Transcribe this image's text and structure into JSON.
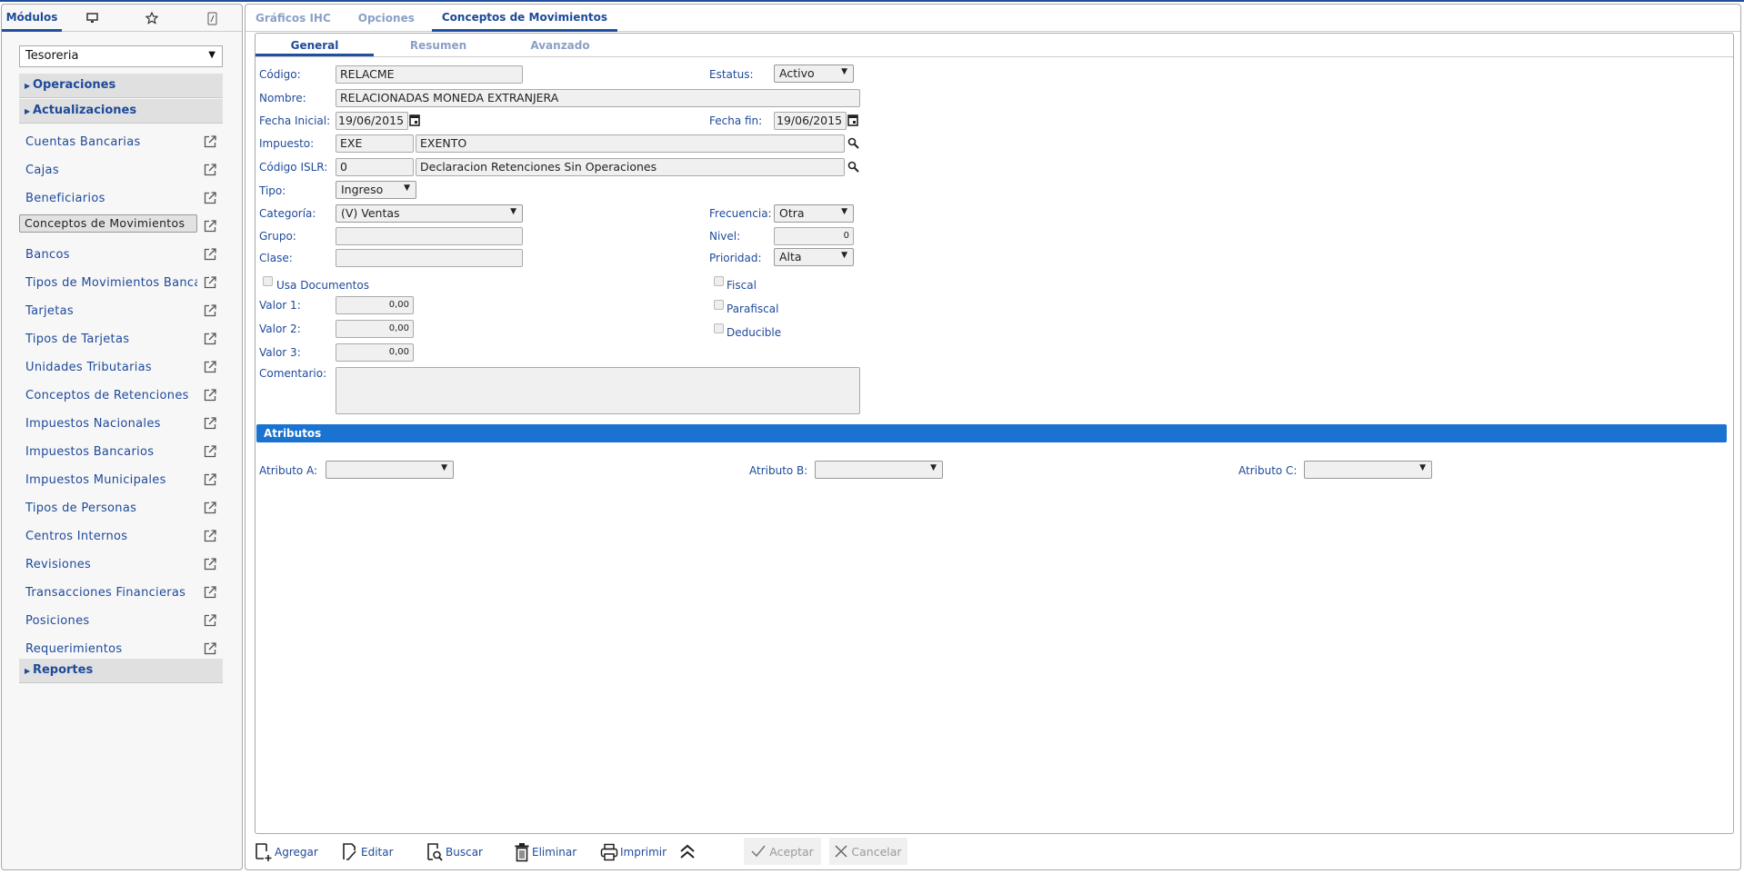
{
  "sidebar": {
    "tabs": [
      {
        "label": "Módulos",
        "icon": "monitor-icon"
      },
      {
        "icon": "star-icon"
      },
      {
        "icon": "key-icon"
      }
    ],
    "module_select": "Tesoreria",
    "groups": {
      "operaciones": "Operaciones",
      "actualizaciones": "Actualizaciones",
      "reportes": "Reportes"
    },
    "items": [
      "Cuentas Bancarias",
      "Cajas",
      "Beneficiarios",
      "Conceptos de Movimientos",
      "Bancos",
      "Tipos de Movimientos Bancar",
      "Tarjetas",
      "Tipos de Tarjetas",
      "Unidades Tributarias",
      "Conceptos de Retenciones",
      "Impuestos Nacionales",
      "Impuestos Bancarios",
      "Impuestos Municipales",
      "Tipos de Personas",
      "Centros Internos",
      "Revisiones",
      "Transacciones Financieras",
      "Posiciones",
      "Requerimientos"
    ],
    "selected_item": "Conceptos de Movimientos"
  },
  "main_tabs": [
    "Gráficos IHC",
    "Opciones",
    "Conceptos de Movimientos"
  ],
  "sub_tabs": [
    "General",
    "Resumen",
    "Avanzado"
  ],
  "form": {
    "codigo": {
      "label": "Código:",
      "value": "RELACME"
    },
    "nombre": {
      "label": "Nombre:",
      "value": "RELACIONADAS MONEDA EXTRANJERA"
    },
    "fecha_inicial": {
      "label": "Fecha Inicial:",
      "value": "19/06/2015"
    },
    "impuesto": {
      "label": "Impuesto:",
      "code": "EXE",
      "desc": "EXENTO"
    },
    "codigo_islr": {
      "label": "Código ISLR:",
      "code": "0",
      "desc": "Declaracion Retenciones Sin Operaciones"
    },
    "tipo": {
      "label": "Tipo:",
      "value": "Ingreso"
    },
    "categoria": {
      "label": "Categoría:",
      "value": "(V) Ventas"
    },
    "grupo": {
      "label": "Grupo:",
      "value": ""
    },
    "clase": {
      "label": "Clase:",
      "value": ""
    },
    "usa_documentos": {
      "label": "Usa Documentos",
      "checked": false
    },
    "valor1": {
      "label": "Valor 1:",
      "value": "0,00"
    },
    "valor2": {
      "label": "Valor 2:",
      "value": "0,00"
    },
    "valor3": {
      "label": "Valor 3:",
      "value": "0,00"
    },
    "comentario": {
      "label": "Comentario:",
      "value": ""
    },
    "estatus": {
      "label": "Estatus:",
      "value": "Activo"
    },
    "fecha_fin": {
      "label": "Fecha fin:",
      "value": "19/06/2015"
    },
    "frecuencia": {
      "label": "Frecuencia:",
      "value": "Otra"
    },
    "nivel": {
      "label": "Nivel:",
      "value": "0"
    },
    "prioridad": {
      "label": "Prioridad:",
      "value": "Alta"
    },
    "fiscal": {
      "label": "Fiscal",
      "checked": false
    },
    "parafiscal": {
      "label": "Parafiscal",
      "checked": false
    },
    "deducible": {
      "label": "Deducible",
      "checked": false
    }
  },
  "atributos": {
    "title": "Atributos",
    "a": {
      "label": "Atributo A:",
      "value": ""
    },
    "b": {
      "label": "Atributo B:",
      "value": ""
    },
    "c": {
      "label": "Atributo C:",
      "value": ""
    }
  },
  "toolbar": {
    "agregar": "Agregar",
    "editar": "Editar",
    "buscar": "Buscar",
    "eliminar": "Eliminar",
    "imprimir": "Imprimir",
    "aceptar": "Aceptar",
    "cancelar": "Cancelar"
  },
  "colors": {
    "accent": "#1f4f9e",
    "section_bar": "#1a73d0",
    "text": "#1e4a9a"
  }
}
